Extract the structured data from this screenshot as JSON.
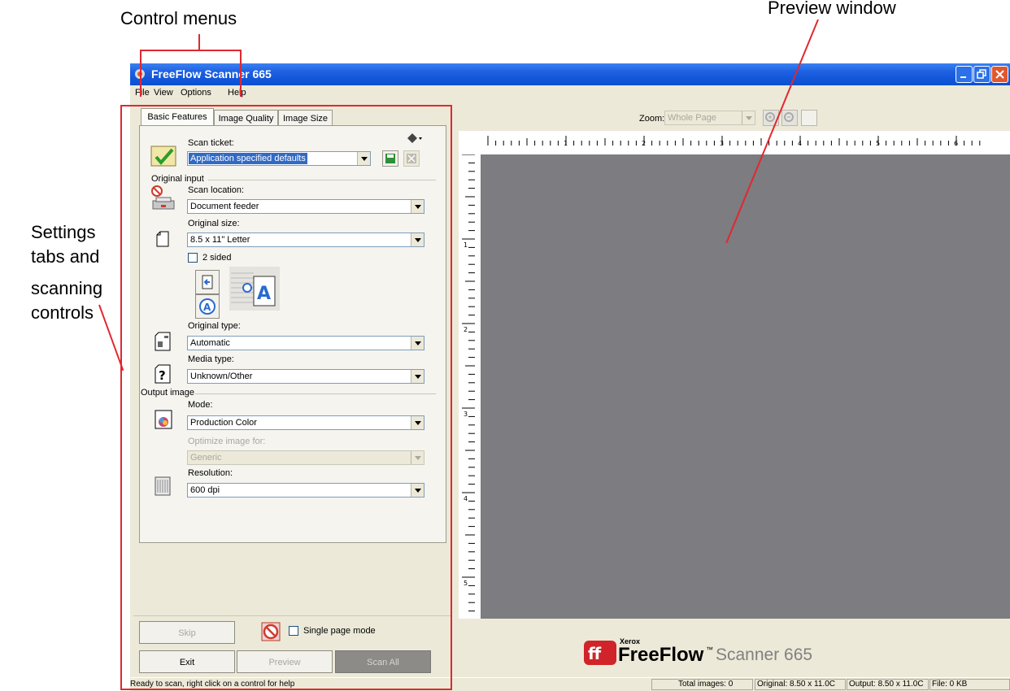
{
  "annotations": {
    "control_menus": "Control menus",
    "preview_window": "Preview window",
    "settings_line1": "Settings",
    "settings_line2": "tabs and",
    "settings_line3": "scanning",
    "settings_line4": "controls"
  },
  "window": {
    "title": "FreeFlow Scanner 665"
  },
  "menu": [
    "File",
    "View",
    "Options",
    "Help"
  ],
  "tabs": [
    "Basic Features",
    "Image Quality",
    "Image Size"
  ],
  "scan_ticket": {
    "label": "Scan ticket:",
    "value": "Application specified defaults"
  },
  "original_input": {
    "header": "Original input",
    "scan_location_label": "Scan location:",
    "scan_location_value": "Document feeder",
    "original_size_label": "Original size:",
    "original_size_value": "8.5 x 11\" Letter",
    "two_sided_label": "2 sided",
    "original_type_label": "Original type:",
    "original_type_value": "Automatic",
    "media_type_label": "Media type:",
    "media_type_value": "Unknown/Other"
  },
  "output_image": {
    "header": "Output image",
    "mode_label": "Mode:",
    "mode_value": "Production Color",
    "optimize_label": "Optimize image for:",
    "optimize_value": "Generic",
    "resolution_label": "Resolution:",
    "resolution_value": "600 dpi"
  },
  "buttons": {
    "skip": "Skip",
    "single_page_mode": "Single page mode",
    "exit": "Exit",
    "preview": "Preview",
    "scan_all": "Scan All"
  },
  "zoom": {
    "label": "Zoom:",
    "value": "Whole Page"
  },
  "ruler": {
    "h_ticks": [
      "1",
      "2",
      "3",
      "4",
      "5",
      "6"
    ],
    "v_ticks": [
      "1",
      "2",
      "3",
      "4",
      "5"
    ]
  },
  "brand": {
    "company": "Xerox",
    "product": "FreeFlow",
    "tm": "™",
    "model": "Scanner 665"
  },
  "status": {
    "message": "Ready to scan, right click on a control for help",
    "total_images": "Total images: 0",
    "original": "Original: 8.50 x 11.0C",
    "output": "Output: 8.50 x 11.0C",
    "file": "File: 0 KB"
  },
  "colors": {
    "annotation_red": "#e0282f",
    "title_blue": "#0a4fd2",
    "preview_gray": "#7d7c80"
  }
}
